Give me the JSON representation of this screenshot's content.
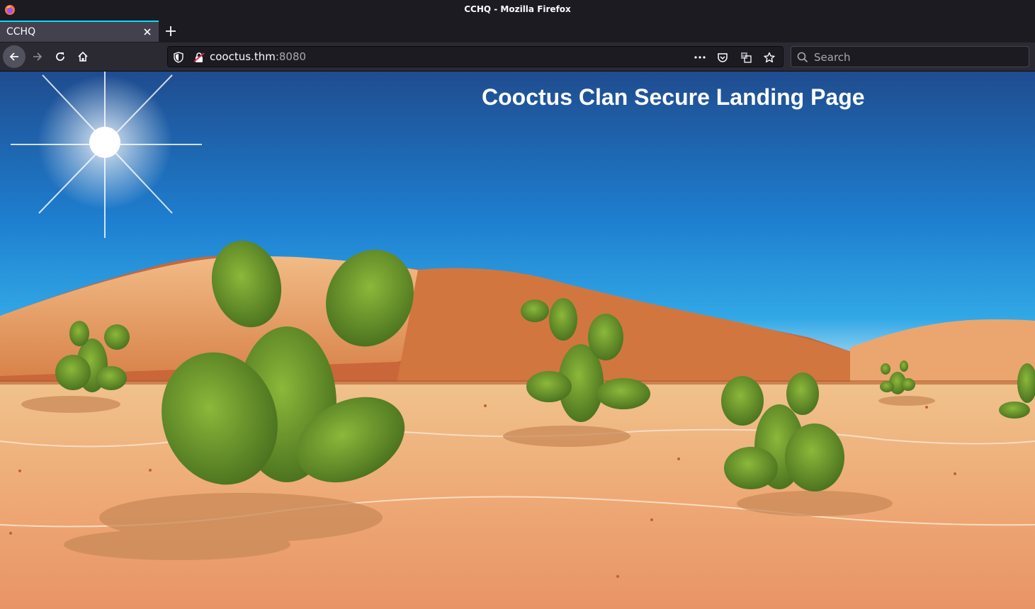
{
  "window": {
    "title": "CCHQ - Mozilla Firefox"
  },
  "tabs": [
    {
      "label": "CCHQ",
      "active": true
    }
  ],
  "toolbar": {
    "url_host": "cooctus.thm",
    "url_port": ":8080",
    "search_placeholder": "Search"
  },
  "page": {
    "heading": "Cooctus Clan Secure Landing Page",
    "background": "desert-cactus-illustration"
  },
  "colors": {
    "accent": "#00ddff",
    "sky_top": "#1f4c8f",
    "sky_bottom": "#eaf6fb",
    "sand": "#e8a46e",
    "cactus": "#6e9a2c"
  }
}
